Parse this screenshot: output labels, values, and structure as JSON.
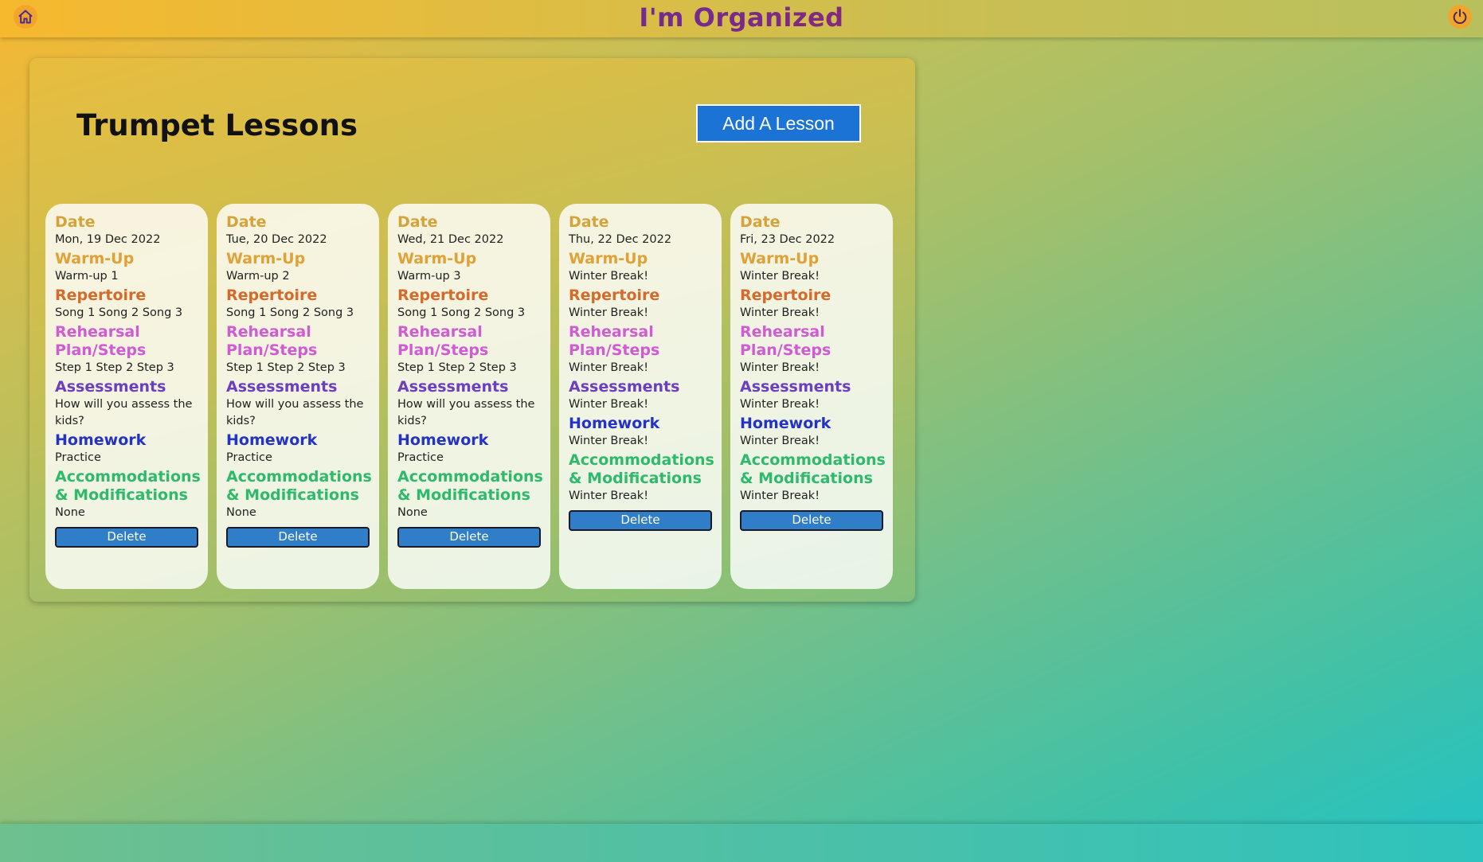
{
  "header": {
    "title": "I'm Organized",
    "home_icon": "home-icon",
    "power_icon": "power-icon"
  },
  "page": {
    "title": "Trumpet Lessons",
    "add_label": "Add A Lesson"
  },
  "labels": {
    "date": "Date",
    "warmup": "Warm-Up",
    "repertoire": "Repertoire",
    "rehearsal": "Rehearsal Plan/Steps",
    "assessments": "Assessments",
    "homework": "Homework",
    "accommodations": "Accommodations & Modifications",
    "delete": "Delete"
  },
  "lessons": [
    {
      "date": "Mon, 19 Dec 2022",
      "warmup": "Warm-up 1",
      "repertoire": "Song 1 Song 2 Song 3",
      "rehearsal": "Step 1 Step 2 Step 3",
      "assessments": "How will you assess the kids?",
      "homework": "Practice",
      "accommodations": "None"
    },
    {
      "date": "Tue, 20 Dec 2022",
      "warmup": "Warm-up 2",
      "repertoire": "Song 1 Song 2 Song 3",
      "rehearsal": "Step 1 Step 2 Step 3",
      "assessments": "How will you assess the kids?",
      "homework": "Practice",
      "accommodations": "None"
    },
    {
      "date": "Wed, 21 Dec 2022",
      "warmup": "Warm-up 3",
      "repertoire": "Song 1 Song 2 Song 3",
      "rehearsal": "Step 1 Step 2 Step 3",
      "assessments": "How will you assess the kids?",
      "homework": "Practice",
      "accommodations": "None"
    },
    {
      "date": "Thu, 22 Dec 2022",
      "warmup": "Winter Break!",
      "repertoire": "Winter Break!",
      "rehearsal": "Winter Break!",
      "assessments": "Winter Break!",
      "homework": "Winter Break!",
      "accommodations": "Winter Break!"
    },
    {
      "date": "Fri, 23 Dec 2022",
      "warmup": "Winter Break!",
      "repertoire": "Winter Break!",
      "rehearsal": "Winter Break!",
      "assessments": "Winter Break!",
      "homework": "Winter Break!",
      "accommodations": "Winter Break!"
    }
  ]
}
